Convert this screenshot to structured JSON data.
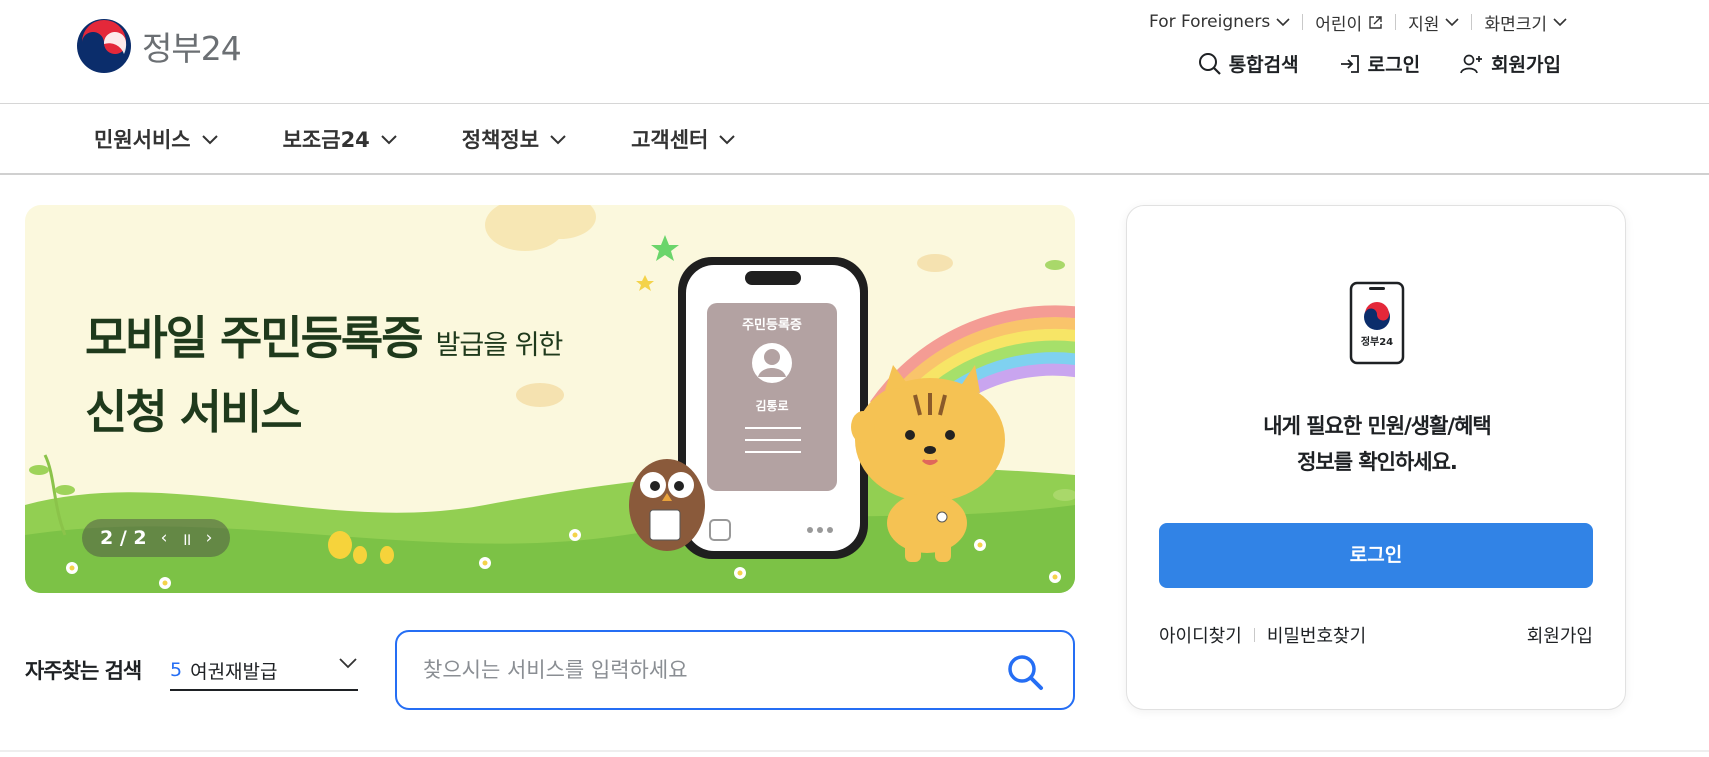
{
  "header": {
    "logo_text": "정부24",
    "util_links": [
      {
        "label": "For Foreigners",
        "icon": "chevron-down-icon"
      },
      {
        "label": "어린이",
        "icon": "external-link-icon"
      },
      {
        "label": "지원",
        "icon": "chevron-down-icon"
      },
      {
        "label": "화면크기",
        "icon": "chevron-down-icon"
      }
    ],
    "top_actions": [
      {
        "label": "통합검색",
        "icon": "search-icon"
      },
      {
        "label": "로그인",
        "icon": "login-icon"
      },
      {
        "label": "회원가입",
        "icon": "user-add-icon"
      }
    ]
  },
  "nav": {
    "items": [
      {
        "label": "민원서비스"
      },
      {
        "label": "보조금24"
      },
      {
        "label": "정책정보"
      },
      {
        "label": "고객센터"
      }
    ]
  },
  "banner": {
    "title_line1": "모바일 주민등록증",
    "title_line1_small": "발급을 위한",
    "title_line2": "신청 서비스",
    "card_title": "주민등록증",
    "card_name": "김통로",
    "counter": "2 / 2",
    "prev_symbol": "‹",
    "pause_symbol": "॥",
    "next_symbol": "›"
  },
  "search": {
    "favorites_label": "자주찾는 검색",
    "selected_rank": "5",
    "selected_term": "여권재발급",
    "placeholder": "찾으시는 서비스를 입력하세요"
  },
  "login_card": {
    "phone_label": "정부24",
    "message_line1": "내게 필요한 민원/생활/혜택",
    "message_line2": "정보를 확인하세요.",
    "login_button": "로그인",
    "find_id": "아이디찾기",
    "find_password": "비밀번호찾기",
    "signup": "회원가입"
  },
  "colors": {
    "primary": "#3183e6",
    "accent_blue": "#256ef4",
    "text": "#1e2124"
  }
}
